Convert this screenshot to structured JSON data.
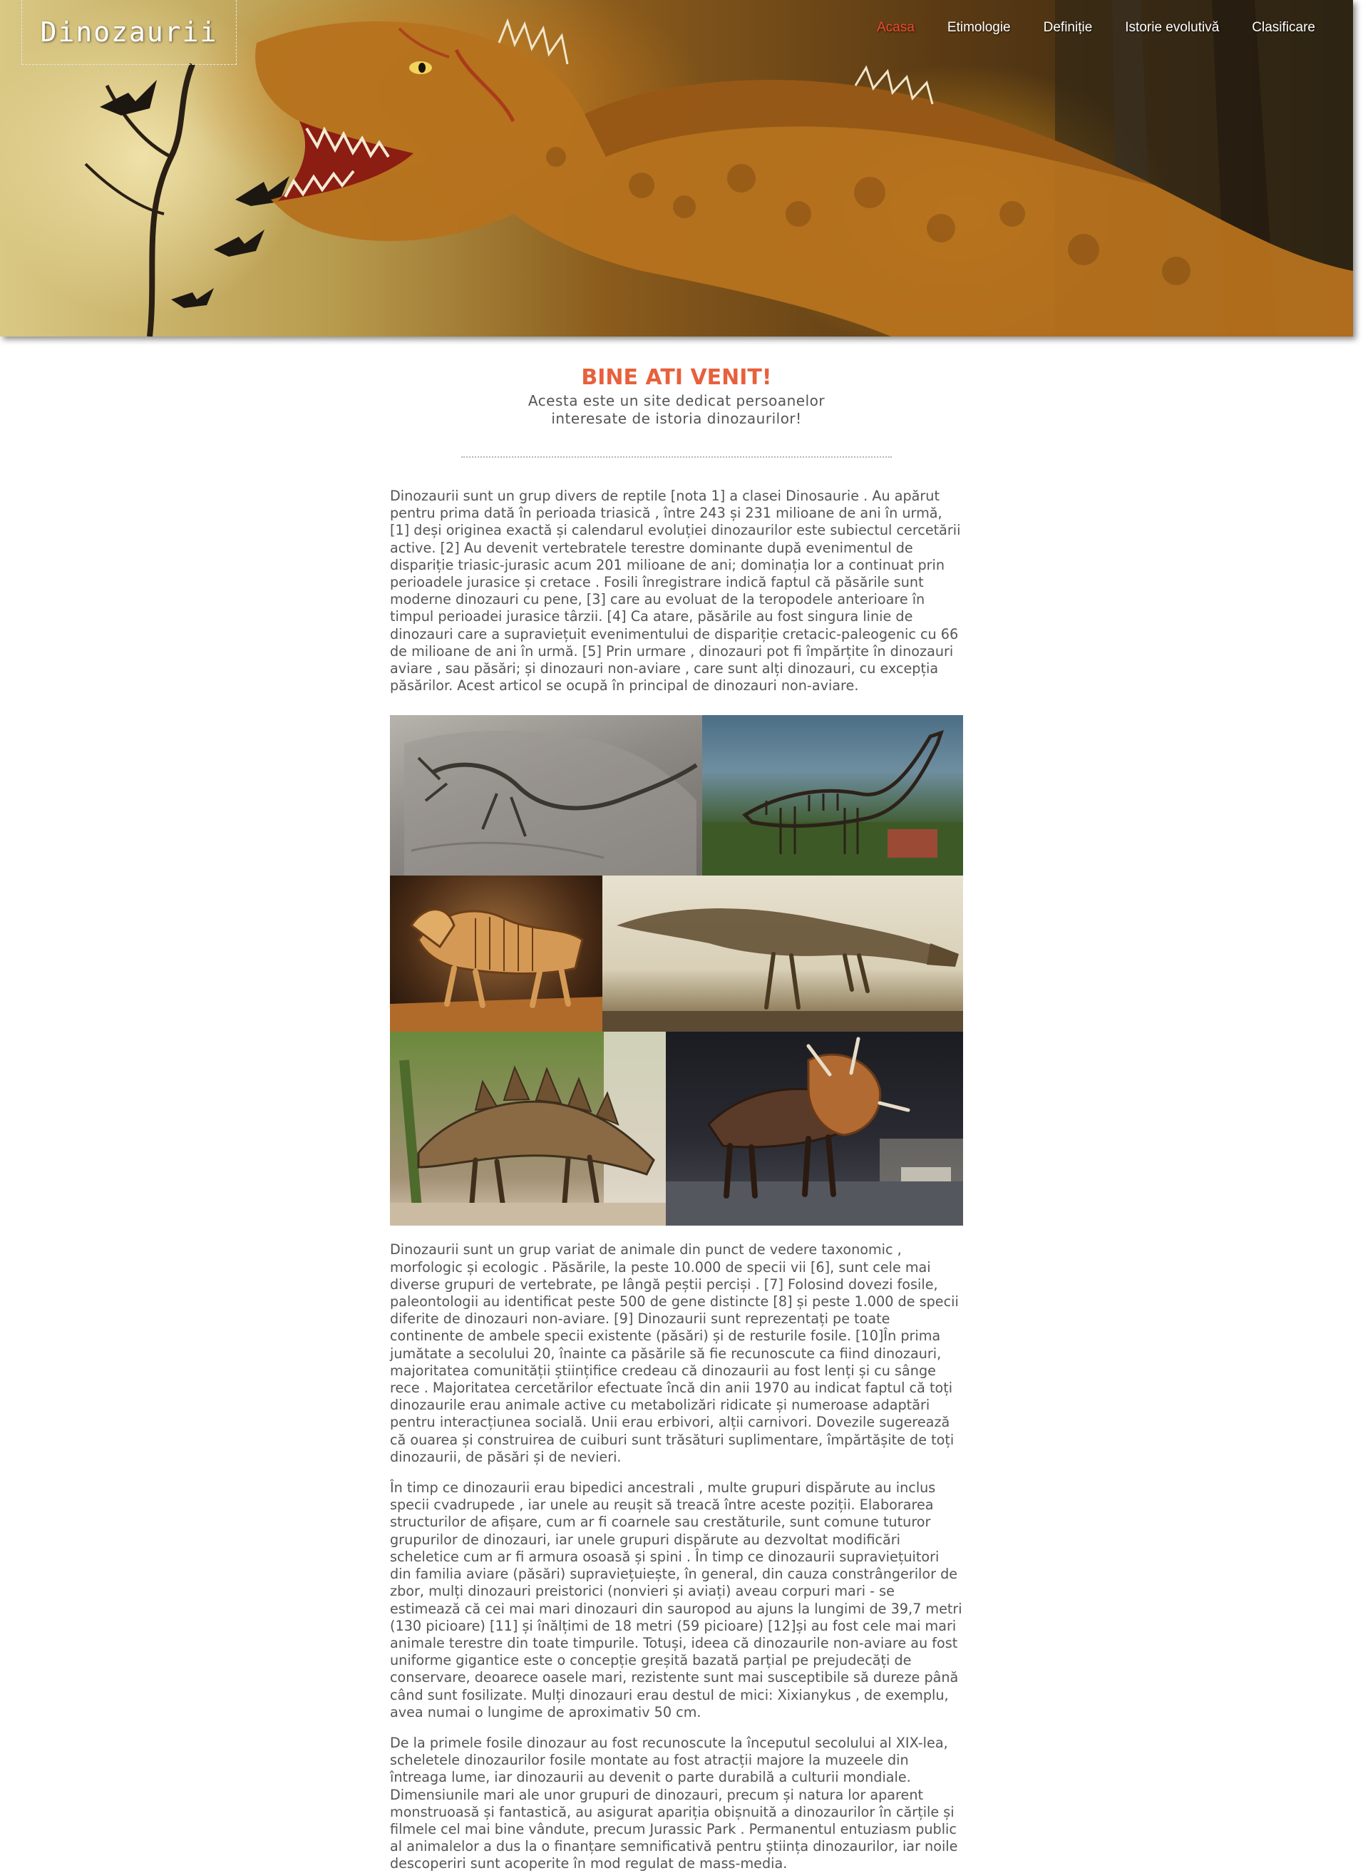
{
  "site": {
    "logo": "Dinozaurii"
  },
  "nav": {
    "items": [
      {
        "label": "Acasa",
        "active": true
      },
      {
        "label": "Etimologie",
        "active": false
      },
      {
        "label": "Definiție",
        "active": false
      },
      {
        "label": "Istorie evolutivă",
        "active": false
      },
      {
        "label": "Clasificare",
        "active": false
      }
    ]
  },
  "welcome": {
    "title": "BINE ATI VENIT!",
    "subtitle": "Acesta este un site dedicat persoanelor interesate de istoria dinozaurilor!"
  },
  "article": {
    "p1": "Dinozaurii sunt un grup divers de reptile [nota 1] a clasei Dinosaurie . Au apărut pentru prima dată în perioada triasică , între 243 și 231 milioane de ani în urmă, [1] deși originea exactă și calendarul evoluției dinozaurilor este subiectul cercetării active. [2] Au devenit vertebratele terestre dominante după evenimentul de dispariție triasic-jurasic acum 201 milioane de ani; dominația lor a continuat prin perioadele jurasice și cretace . Fosili înregistrare indică faptul că păsările sunt moderne dinozauri cu pene, [3] care au evoluat de la teropodele anterioare în timpul perioadei jurasice târzii. [4] Ca atare, păsările au fost singura linie de dinozauri care a supraviețuit evenimentului de dispariție cretacic-paleogenic cu 66 de milioane de ani în urmă. [5] Prin urmare , dinozauri pot fi împărțite în dinozauri aviare , sau păsări; și dinozauri non-aviare , care sunt alți dinozauri, cu excepția păsărilor. Acest articol se ocupă în principal de dinozauri non-aviare.",
    "p2": "Dinozaurii sunt un grup variat de animale din punct de vedere taxonomic , morfologic și ecologic . Păsările, la peste 10.000 de specii vii [6], sunt cele mai diverse grupuri de vertebrate, pe lângă peștii perciși . [7] Folosind dovezi fosile, paleontologii au identificat peste 500 de gene distincte [8] și peste 1.000 de specii diferite de dinozauri non-aviare. [9] Dinozaurii sunt reprezentați pe toate continente de ambele specii existente (păsări) și de resturile fosile. [10]În prima jumătate a secolului 20, înainte ca păsările să fie recunoscute ca fiind dinozauri, majoritatea comunității științifice credeau că dinozaurii au fost lenți și cu sânge rece . Majoritatea cercetărilor efectuate încă din anii 1970 au indicat faptul că toți dinozaurile erau animale active cu metabolizări ridicate și numeroase adaptări pentru interacțiunea socială. Unii erau erbivori, alții carnivori. Dovezile sugerează că ouarea și construirea de cuiburi sunt trăsături suplimentare, împărtășite de toți dinozaurii, de păsări și de nevieri.",
    "p3": "În timp ce dinozaurii erau bipedici ancestrali , multe grupuri dispărute au inclus specii cvadrupede , iar unele au reușit să treacă între aceste poziții. Elaborarea structurilor de afișare, cum ar fi coarnele sau crestăturile, sunt comune tuturor grupurilor de dinozauri, iar unele grupuri dispărute au dezvoltat modificări scheletice cum ar fi armura osoasă și spini . În timp ce dinozaurii supraviețuitori din familia aviare (păsări) supraviețuiește, în general, din cauza constrângerilor de zbor, mulți dinozauri preistorici (nonvieri și aviați) aveau corpuri mari - se estimează că cei mai mari dinozauri din sauropod au ajuns la lungimi de 39,7 metri (130 picioare) [11] și înălțimi de 18 metri (59 picioare) [12]și au fost cele mai mari animale terestre din toate timpurile. Totuși, ideea că dinozaurile non-aviare au fost uniforme gigantice este o concepție greșită bazată parțial pe prejudecăți de conservare, deoarece oasele mari, rezistente sunt mai susceptibile să dureze până când sunt fosilizate. Mulți dinozauri erau destul de mici: Xixianykus , de exemplu, avea numai o lungime de aproximativ 50 cm.",
    "p4": "De la primele fosile dinozaur au fost recunoscute la începutul secolului al XIX-lea, scheletele dinozaurilor fosile montate au fost atracții majore la muzeele din întreaga lume, iar dinozaurii au devenit o parte durabilă a culturii mondiale. Dimensiunile mari ale unor grupuri de dinozauri, precum și natura lor aparent monstruoasă și fantastică, au asigurat apariția obișnuită a dinozaurilor în cărțile și filmele cel mai bine vândute, precum Jurassic Park . Permanentul entuziasm public al animalelor a dus la o finanțare semnificativă pentru știința dinozaurilor, iar noile descoperiri sunt acoperite în mod regulat de mass-media."
  },
  "colors": {
    "accent": "#ee4a2c",
    "title": "#e8603c",
    "text": "#555555"
  }
}
